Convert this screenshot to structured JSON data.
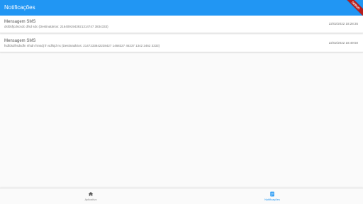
{
  "appbar": {
    "title": "Notificações",
    "debug_banner": "DEBUG",
    "color": "#2196f3"
  },
  "notifications": [
    {
      "title": "Mensagem SMS",
      "body": "dsfdsfjcdscsdc dfsd sdc (Destinatários: 2164091943921314747 3834333)",
      "time": "22/02/2022 18:28:35"
    },
    {
      "title": "Mensagem SMS",
      "body": "fsdfdsdfrsdsdfn nfsdn fsnsdj fn sdfsjd ns (Destinatários: 2147233842238427 1468327 46237 1342 2462 3333)",
      "time": "22/02/2022 18:49:50"
    }
  ],
  "bottom_nav": {
    "items": [
      {
        "label": "Aplicativo",
        "icon": "home-icon",
        "active": false
      },
      {
        "label": "Notificações",
        "icon": "notifications-list-icon",
        "active": true
      }
    ],
    "active_color": "#2196f3",
    "inactive_color": "#888888"
  }
}
